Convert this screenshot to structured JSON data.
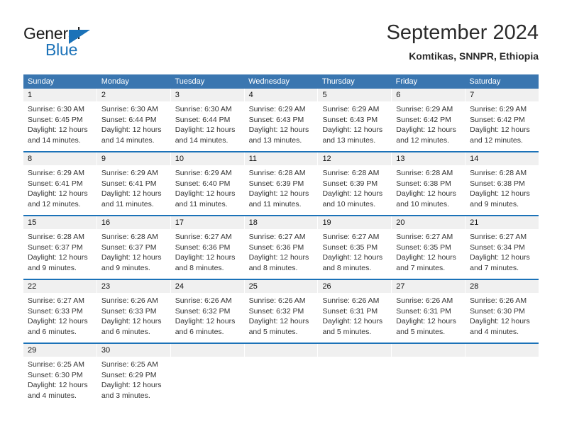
{
  "brand": {
    "name_part1": "General",
    "name_part2": "Blue",
    "triangle_color": "#1b72b8"
  },
  "header": {
    "title": "September 2024",
    "subtitle": "Komtikas, SNNPR, Ethiopia"
  },
  "theme": {
    "header_band": "#3a76b0",
    "week_divider": "#1b72b8",
    "daynum_band": "#f0f0f0"
  },
  "weekdays": [
    "Sunday",
    "Monday",
    "Tuesday",
    "Wednesday",
    "Thursday",
    "Friday",
    "Saturday"
  ],
  "weeks": [
    [
      {
        "day": "1",
        "sunrise": "Sunrise: 6:30 AM",
        "sunset": "Sunset: 6:45 PM",
        "daylight1": "Daylight: 12 hours",
        "daylight2": "and 14 minutes."
      },
      {
        "day": "2",
        "sunrise": "Sunrise: 6:30 AM",
        "sunset": "Sunset: 6:44 PM",
        "daylight1": "Daylight: 12 hours",
        "daylight2": "and 14 minutes."
      },
      {
        "day": "3",
        "sunrise": "Sunrise: 6:30 AM",
        "sunset": "Sunset: 6:44 PM",
        "daylight1": "Daylight: 12 hours",
        "daylight2": "and 14 minutes."
      },
      {
        "day": "4",
        "sunrise": "Sunrise: 6:29 AM",
        "sunset": "Sunset: 6:43 PM",
        "daylight1": "Daylight: 12 hours",
        "daylight2": "and 13 minutes."
      },
      {
        "day": "5",
        "sunrise": "Sunrise: 6:29 AM",
        "sunset": "Sunset: 6:43 PM",
        "daylight1": "Daylight: 12 hours",
        "daylight2": "and 13 minutes."
      },
      {
        "day": "6",
        "sunrise": "Sunrise: 6:29 AM",
        "sunset": "Sunset: 6:42 PM",
        "daylight1": "Daylight: 12 hours",
        "daylight2": "and 12 minutes."
      },
      {
        "day": "7",
        "sunrise": "Sunrise: 6:29 AM",
        "sunset": "Sunset: 6:42 PM",
        "daylight1": "Daylight: 12 hours",
        "daylight2": "and 12 minutes."
      }
    ],
    [
      {
        "day": "8",
        "sunrise": "Sunrise: 6:29 AM",
        "sunset": "Sunset: 6:41 PM",
        "daylight1": "Daylight: 12 hours",
        "daylight2": "and 12 minutes."
      },
      {
        "day": "9",
        "sunrise": "Sunrise: 6:29 AM",
        "sunset": "Sunset: 6:41 PM",
        "daylight1": "Daylight: 12 hours",
        "daylight2": "and 11 minutes."
      },
      {
        "day": "10",
        "sunrise": "Sunrise: 6:29 AM",
        "sunset": "Sunset: 6:40 PM",
        "daylight1": "Daylight: 12 hours",
        "daylight2": "and 11 minutes."
      },
      {
        "day": "11",
        "sunrise": "Sunrise: 6:28 AM",
        "sunset": "Sunset: 6:39 PM",
        "daylight1": "Daylight: 12 hours",
        "daylight2": "and 11 minutes."
      },
      {
        "day": "12",
        "sunrise": "Sunrise: 6:28 AM",
        "sunset": "Sunset: 6:39 PM",
        "daylight1": "Daylight: 12 hours",
        "daylight2": "and 10 minutes."
      },
      {
        "day": "13",
        "sunrise": "Sunrise: 6:28 AM",
        "sunset": "Sunset: 6:38 PM",
        "daylight1": "Daylight: 12 hours",
        "daylight2": "and 10 minutes."
      },
      {
        "day": "14",
        "sunrise": "Sunrise: 6:28 AM",
        "sunset": "Sunset: 6:38 PM",
        "daylight1": "Daylight: 12 hours",
        "daylight2": "and 9 minutes."
      }
    ],
    [
      {
        "day": "15",
        "sunrise": "Sunrise: 6:28 AM",
        "sunset": "Sunset: 6:37 PM",
        "daylight1": "Daylight: 12 hours",
        "daylight2": "and 9 minutes."
      },
      {
        "day": "16",
        "sunrise": "Sunrise: 6:28 AM",
        "sunset": "Sunset: 6:37 PM",
        "daylight1": "Daylight: 12 hours",
        "daylight2": "and 9 minutes."
      },
      {
        "day": "17",
        "sunrise": "Sunrise: 6:27 AM",
        "sunset": "Sunset: 6:36 PM",
        "daylight1": "Daylight: 12 hours",
        "daylight2": "and 8 minutes."
      },
      {
        "day": "18",
        "sunrise": "Sunrise: 6:27 AM",
        "sunset": "Sunset: 6:36 PM",
        "daylight1": "Daylight: 12 hours",
        "daylight2": "and 8 minutes."
      },
      {
        "day": "19",
        "sunrise": "Sunrise: 6:27 AM",
        "sunset": "Sunset: 6:35 PM",
        "daylight1": "Daylight: 12 hours",
        "daylight2": "and 8 minutes."
      },
      {
        "day": "20",
        "sunrise": "Sunrise: 6:27 AM",
        "sunset": "Sunset: 6:35 PM",
        "daylight1": "Daylight: 12 hours",
        "daylight2": "and 7 minutes."
      },
      {
        "day": "21",
        "sunrise": "Sunrise: 6:27 AM",
        "sunset": "Sunset: 6:34 PM",
        "daylight1": "Daylight: 12 hours",
        "daylight2": "and 7 minutes."
      }
    ],
    [
      {
        "day": "22",
        "sunrise": "Sunrise: 6:27 AM",
        "sunset": "Sunset: 6:33 PM",
        "daylight1": "Daylight: 12 hours",
        "daylight2": "and 6 minutes."
      },
      {
        "day": "23",
        "sunrise": "Sunrise: 6:26 AM",
        "sunset": "Sunset: 6:33 PM",
        "daylight1": "Daylight: 12 hours",
        "daylight2": "and 6 minutes."
      },
      {
        "day": "24",
        "sunrise": "Sunrise: 6:26 AM",
        "sunset": "Sunset: 6:32 PM",
        "daylight1": "Daylight: 12 hours",
        "daylight2": "and 6 minutes."
      },
      {
        "day": "25",
        "sunrise": "Sunrise: 6:26 AM",
        "sunset": "Sunset: 6:32 PM",
        "daylight1": "Daylight: 12 hours",
        "daylight2": "and 5 minutes."
      },
      {
        "day": "26",
        "sunrise": "Sunrise: 6:26 AM",
        "sunset": "Sunset: 6:31 PM",
        "daylight1": "Daylight: 12 hours",
        "daylight2": "and 5 minutes."
      },
      {
        "day": "27",
        "sunrise": "Sunrise: 6:26 AM",
        "sunset": "Sunset: 6:31 PM",
        "daylight1": "Daylight: 12 hours",
        "daylight2": "and 5 minutes."
      },
      {
        "day": "28",
        "sunrise": "Sunrise: 6:26 AM",
        "sunset": "Sunset: 6:30 PM",
        "daylight1": "Daylight: 12 hours",
        "daylight2": "and 4 minutes."
      }
    ],
    [
      {
        "day": "29",
        "sunrise": "Sunrise: 6:25 AM",
        "sunset": "Sunset: 6:30 PM",
        "daylight1": "Daylight: 12 hours",
        "daylight2": "and 4 minutes."
      },
      {
        "day": "30",
        "sunrise": "Sunrise: 6:25 AM",
        "sunset": "Sunset: 6:29 PM",
        "daylight1": "Daylight: 12 hours",
        "daylight2": "and 3 minutes."
      },
      {
        "day": "",
        "sunrise": "",
        "sunset": "",
        "daylight1": "",
        "daylight2": ""
      },
      {
        "day": "",
        "sunrise": "",
        "sunset": "",
        "daylight1": "",
        "daylight2": ""
      },
      {
        "day": "",
        "sunrise": "",
        "sunset": "",
        "daylight1": "",
        "daylight2": ""
      },
      {
        "day": "",
        "sunrise": "",
        "sunset": "",
        "daylight1": "",
        "daylight2": ""
      },
      {
        "day": "",
        "sunrise": "",
        "sunset": "",
        "daylight1": "",
        "daylight2": ""
      }
    ]
  ]
}
